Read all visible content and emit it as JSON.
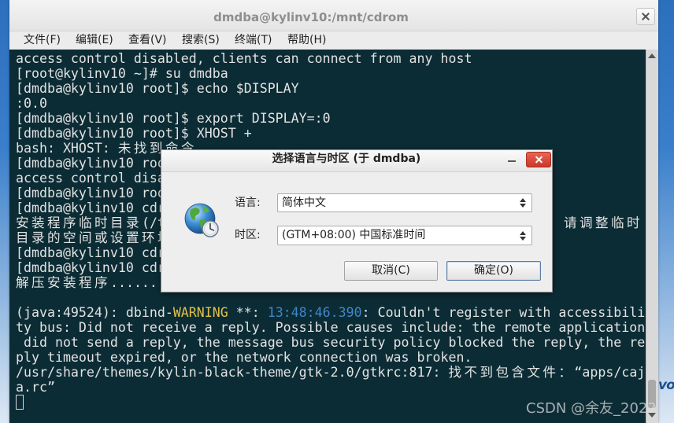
{
  "desktop": {
    "logo_fragment": "vo"
  },
  "window": {
    "title": "dmdba@kylinv10:/mnt/cdrom",
    "close_icon": "close-icon"
  },
  "menu": {
    "items": [
      "文件(F)",
      "编辑(E)",
      "查看(V)",
      "搜索(S)",
      "终端(T)",
      "帮助(H)"
    ]
  },
  "terminal": {
    "colors": {
      "background": "#0c2c35",
      "text": "#e2e2e2",
      "warning": "#e2c048",
      "timestamp": "#3f86c8"
    },
    "lines": [
      "access control disabled, clients can connect from any host",
      "[root@kylinv10 ~]# su dmdba",
      "[dmdba@kylinv10 root]$ echo $DISPLAY",
      ":0.0",
      "[dmdba@kylinv10 root]$ export DISPLAY=:0",
      "[dmdba@kylinv10 root]$ XHOST +",
      [
        "bash: XHOST: ",
        "未找到命令"
      ],
      "[dmdba@kylinv10 roo",
      "access control disa",
      "[dmdba@kylinv10 roo",
      "[dmdba@kylinv10 cdr",
      [
        "安装程序临时目录",
        "(/t",
        "，请调整临时"
      ],
      "目录的空间或设置环境",
      "[dmdba@kylinv10 cdr",
      "[dmdba@kylinv10 cdr",
      [
        "解压安装程序",
        "......"
      ],
      "",
      [
        "(java:49524): dbind-",
        "WARNING",
        " **: ",
        "13:48:46.390",
        ": Couldn't register with accessibili"
      ],
      "ty bus: Did not receive a reply. Possible causes include: the remote application",
      " did not send a reply, the message bus security policy blocked the reply, the re",
      "ply timeout expired, or the network connection was broken.",
      [
        "/usr/share/themes/kylin-black-theme/gtk-2.0/gtkrc:817: ",
        "找不到包含文件：",
        "“apps/caj"
      ],
      "a.rc”"
    ]
  },
  "dialog": {
    "title": "选择语言与时区 (于 dmdba)",
    "icon": "globe-clock-icon",
    "language_label": "语言:",
    "language_value": "简体中文",
    "timezone_label": "时区:",
    "timezone_value": "(GTM+08:00) 中国标准时间",
    "cancel_label": "取消(C)",
    "ok_label": "确定(O)"
  },
  "watermark": "CSDN @余友_2022"
}
